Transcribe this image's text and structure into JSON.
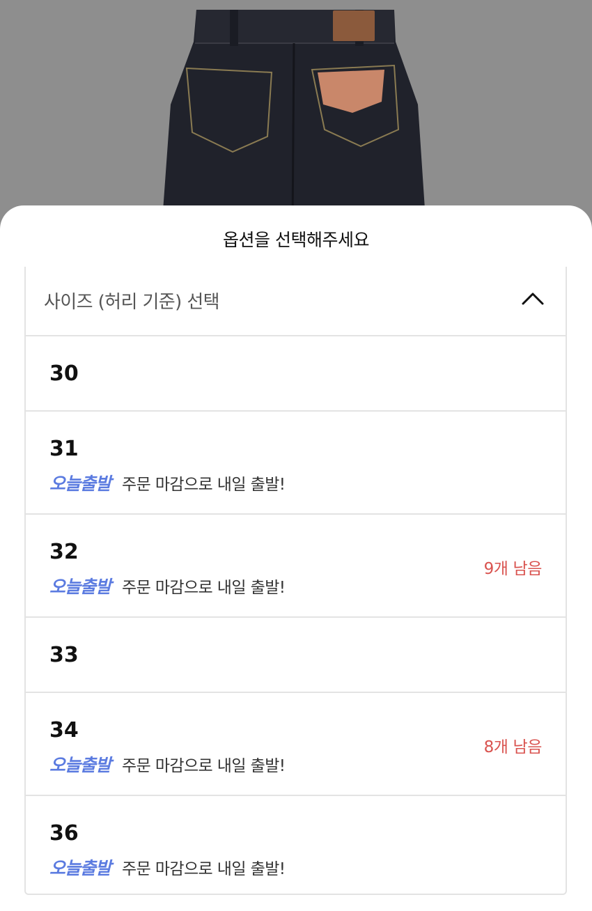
{
  "sheet": {
    "title": "옵션을 선택해주세요",
    "select_label": "사이즈 (허리 기준) 선택"
  },
  "options": [
    {
      "size": "30",
      "ship_badge": "",
      "ship_text": "",
      "stock": ""
    },
    {
      "size": "31",
      "ship_badge": "오늘출발",
      "ship_text": "주문 마감으로 내일 출발!",
      "stock": ""
    },
    {
      "size": "32",
      "ship_badge": "오늘출발",
      "ship_text": "주문 마감으로 내일 출발!",
      "stock": "9개 남음"
    },
    {
      "size": "33",
      "ship_badge": "",
      "ship_text": "",
      "stock": ""
    },
    {
      "size": "34",
      "ship_badge": "오늘출발",
      "ship_text": "주문 마감으로 내일 출발!",
      "stock": "8개 남음"
    },
    {
      "size": "36",
      "ship_badge": "오늘출발",
      "ship_text": "주문 마감으로 내일 출발!",
      "stock": ""
    }
  ],
  "colors": {
    "ship_badge": "#5b7be0",
    "stock": "#d9534f",
    "border": "#e3e3e3"
  },
  "icons": {
    "collapse": "chevron-up-icon"
  }
}
